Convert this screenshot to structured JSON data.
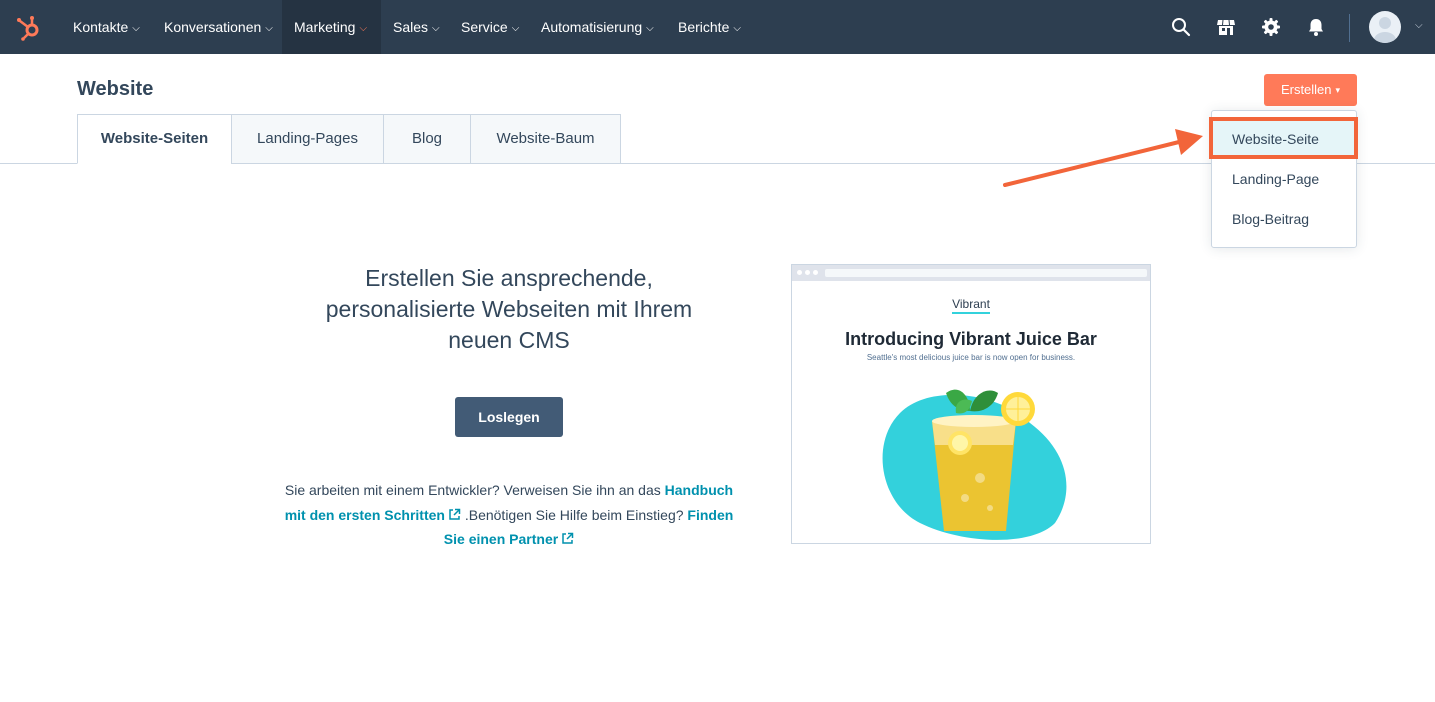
{
  "nav": {
    "items": [
      {
        "label": "Kontakte"
      },
      {
        "label": "Konversationen"
      },
      {
        "label": "Marketing"
      },
      {
        "label": "Sales"
      },
      {
        "label": "Service"
      },
      {
        "label": "Automatisierung"
      },
      {
        "label": "Berichte"
      }
    ],
    "active": "Marketing",
    "icons": [
      "search-icon",
      "marketplace-icon",
      "settings-icon",
      "notifications-icon"
    ],
    "chevron": "⌵"
  },
  "header": {
    "title": "Website",
    "create_label": "Erstellen",
    "create_caret": "▾"
  },
  "tabs": [
    {
      "label": "Website-Seiten"
    },
    {
      "label": "Landing-Pages"
    },
    {
      "label": "Blog"
    },
    {
      "label": "Website-Baum"
    }
  ],
  "dropdown": {
    "items": [
      {
        "label": "Website-Seite"
      },
      {
        "label": "Landing-Page"
      },
      {
        "label": "Blog-Beitrag"
      }
    ]
  },
  "empty_state": {
    "heading_line1": "Erstellen Sie ansprechende,",
    "heading_line2": "personalisierte Webseiten mit Ihrem",
    "heading_line3": "neuen CMS",
    "start_label": "Loslegen",
    "help_prefix": "Sie arbeiten mit einem Entwickler? Verweisen Sie ihn an das ",
    "help_link1": "Handbuch mit den ersten Schritten",
    "help_middle": " .Benötigen Sie Hilfe beim Einstieg? ",
    "help_link2": "Finden Sie einen Partner"
  },
  "preview": {
    "brand": "Vibrant",
    "title": "Introducing Vibrant Juice Bar",
    "subtitle": "Seattle's most delicious juice bar is now open for business."
  },
  "colors": {
    "nav_bg": "#2d3e50",
    "accent": "#ff7a59",
    "link": "#0091ae",
    "primary_btn": "#425b76",
    "highlight": "#f2653a"
  }
}
